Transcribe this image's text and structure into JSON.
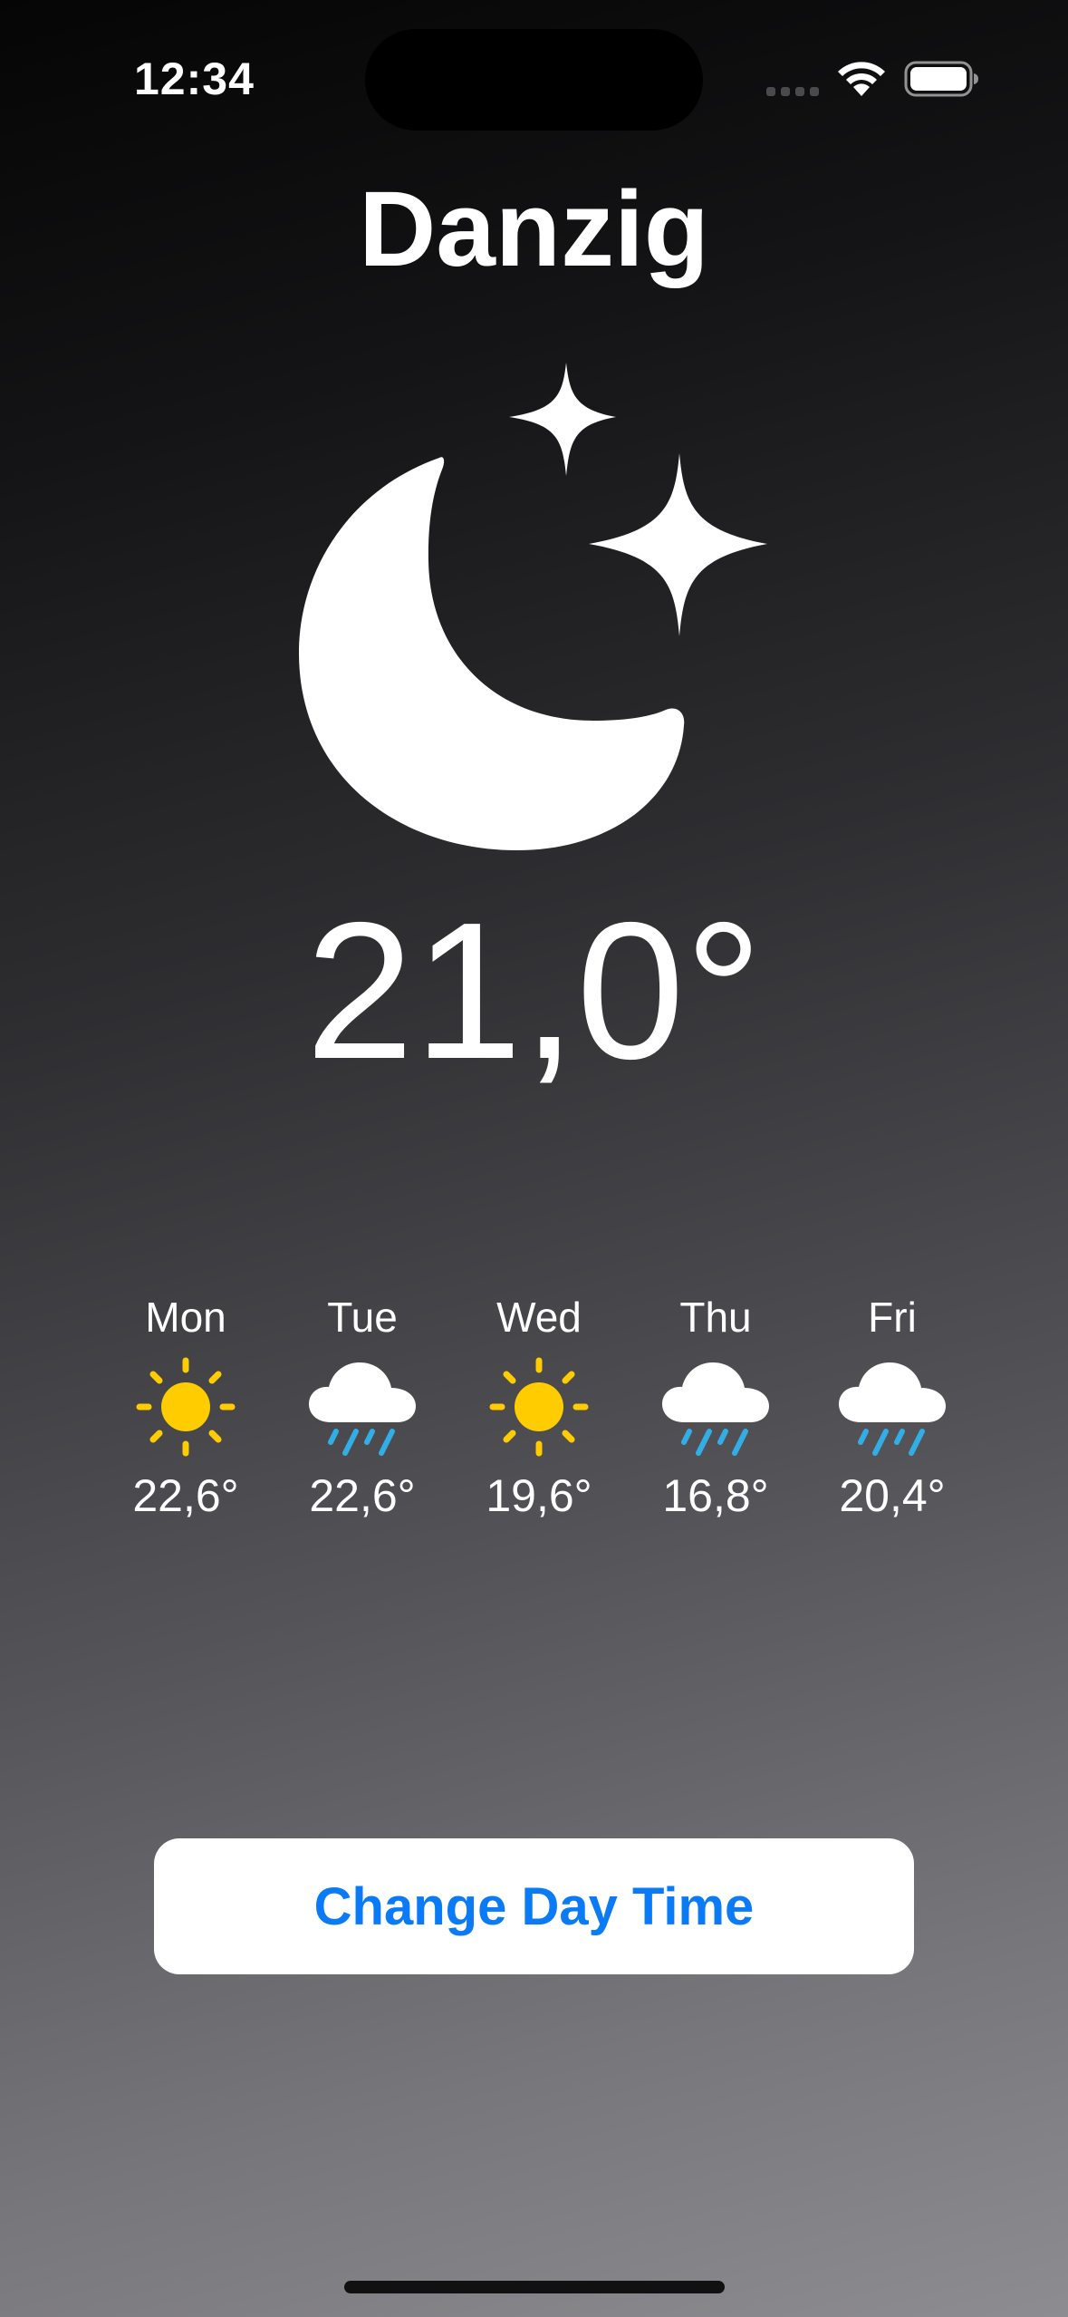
{
  "status_bar": {
    "time": "12:34"
  },
  "city": "Danzig",
  "current": {
    "icon": "moon-stars-icon",
    "temperature": "21,0°"
  },
  "forecast": [
    {
      "day": "Mon",
      "icon": "sun-icon",
      "temp": "22,6°"
    },
    {
      "day": "Tue",
      "icon": "cloud-rain-icon",
      "temp": "22,6°"
    },
    {
      "day": "Wed",
      "icon": "sun-icon",
      "temp": "19,6°"
    },
    {
      "day": "Thu",
      "icon": "cloud-rain-icon",
      "temp": "16,8°"
    },
    {
      "day": "Fri",
      "icon": "cloud-rain-icon",
      "temp": "20,4°"
    }
  ],
  "button": {
    "label": "Change Day Time"
  },
  "colors": {
    "sun": "#FFCC00",
    "rain": "#32ADE6",
    "button_text": "#0A7BF5"
  }
}
